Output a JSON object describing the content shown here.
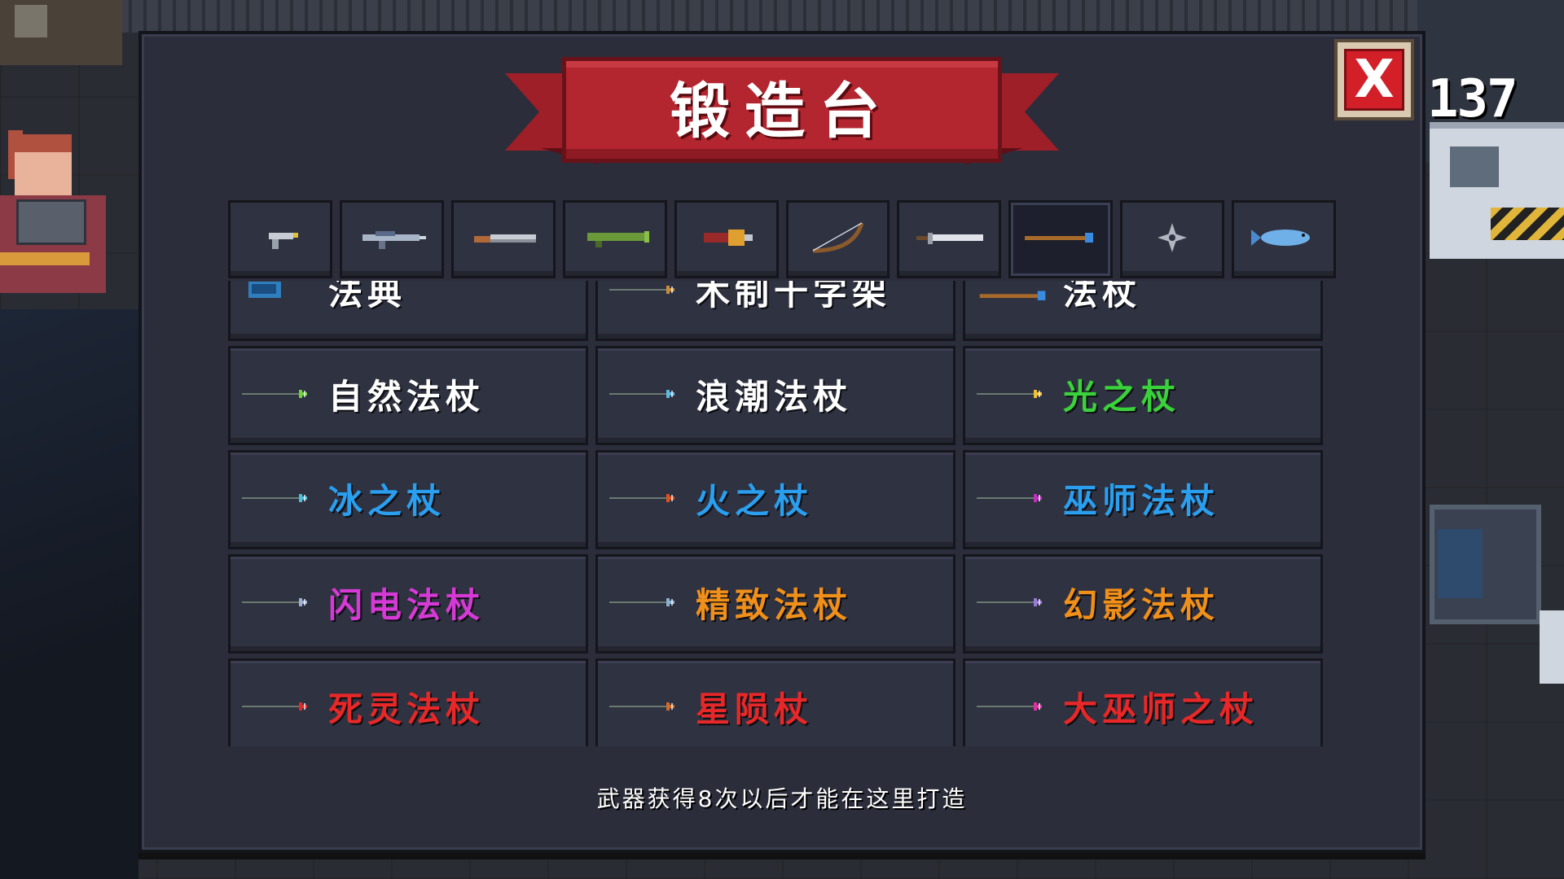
{
  "title": "锻造台",
  "coin_counter": "137",
  "close_label": "X",
  "colors": {
    "panel_bg": "#2b2d3b",
    "banner_red": "#b3252f",
    "close_red": "#d21f28"
  },
  "tabs": [
    {
      "icon": "pistol-icon",
      "active": false
    },
    {
      "icon": "rifle-icon",
      "active": false
    },
    {
      "icon": "shotgun-icon",
      "active": false
    },
    {
      "icon": "rocket-launcher-icon",
      "active": false
    },
    {
      "icon": "laser-gun-icon",
      "active": false
    },
    {
      "icon": "bow-icon",
      "active": false
    },
    {
      "icon": "sword-icon",
      "active": false
    },
    {
      "icon": "staff-icon",
      "active": true
    },
    {
      "icon": "shuriken-icon",
      "active": false
    },
    {
      "icon": "fish-icon",
      "active": false
    }
  ],
  "weapons": [
    {
      "name": "法典",
      "color": "#ffffff",
      "icon": "codex-icon",
      "icon_color": "#2f7fbf"
    },
    {
      "name": "木制十字架",
      "color": "#ffffff",
      "icon": "cross-icon",
      "icon_color": "#c98a3a"
    },
    {
      "name": "法杖",
      "color": "#ffffff",
      "icon": "staff-icon",
      "icon_color": "#c98a3a"
    },
    {
      "name": "自然法杖",
      "color": "#ffffff",
      "icon": "nature-staff-icon",
      "icon_color": "#6fd43a"
    },
    {
      "name": "浪潮法杖",
      "color": "#ffffff",
      "icon": "wave-staff-icon",
      "icon_color": "#5fb8e0"
    },
    {
      "name": "光之杖",
      "color": "#3ad23a",
      "icon": "light-staff-icon",
      "icon_color": "#f0c030"
    },
    {
      "name": "冰之杖",
      "color": "#2a9ff0",
      "icon": "ice-staff-icon",
      "icon_color": "#4ac0d8"
    },
    {
      "name": "火之杖",
      "color": "#2a9ff0",
      "icon": "fire-staff-icon",
      "icon_color": "#e0501a"
    },
    {
      "name": "巫师法杖",
      "color": "#2a9ff0",
      "icon": "wizard-staff-icon",
      "icon_color": "#c030c0"
    },
    {
      "name": "闪电法杖",
      "color": "#d63ad6",
      "icon": "lightning-staff-icon",
      "icon_color": "#a0b0d0"
    },
    {
      "name": "精致法杖",
      "color": "#f0901a",
      "icon": "fine-staff-icon",
      "icon_color": "#8ab0d0"
    },
    {
      "name": "幻影法杖",
      "color": "#f0901a",
      "icon": "phantom-staff-icon",
      "icon_color": "#9a7ad8"
    },
    {
      "name": "死灵法杖",
      "color": "#e82828",
      "icon": "necro-staff-icon",
      "icon_color": "#e02a2a"
    },
    {
      "name": "星陨杖",
      "color": "#e82828",
      "icon": "meteor-staff-icon",
      "icon_color": "#d06a2a"
    },
    {
      "name": "大巫师之杖",
      "color": "#e82828",
      "icon": "archmage-staff-icon",
      "icon_color": "#e030a0"
    }
  ],
  "footer_text": "武器获得8次以后才能在这里打造"
}
